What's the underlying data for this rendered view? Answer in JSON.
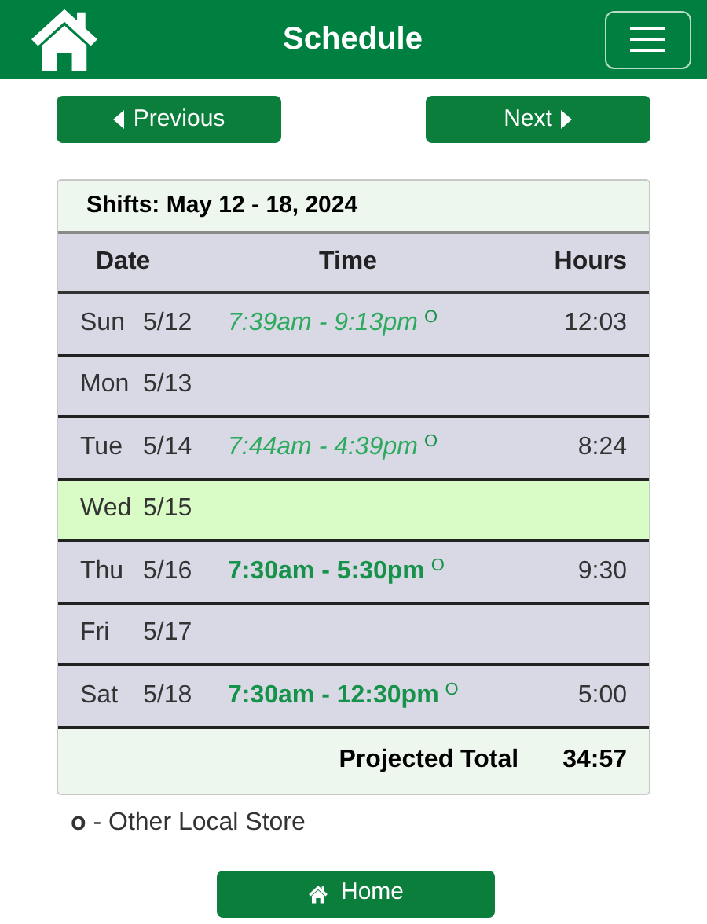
{
  "header": {
    "title": "Schedule"
  },
  "nav": {
    "previous": "Previous",
    "next": "Next"
  },
  "table": {
    "title": "Shifts: May 12 - 18, 2024",
    "columns": [
      "Date",
      "Time",
      "Hours"
    ],
    "rows": [
      {
        "day": "Sun",
        "date": "5/12",
        "time": "7:39am - 9:13pm",
        "kind": "past",
        "store_mark": "O",
        "hours": "12:03",
        "selected": false
      },
      {
        "day": "Mon",
        "date": "5/13",
        "selected": false
      },
      {
        "day": "Tue",
        "date": "5/14",
        "time": "7:44am - 4:39pm",
        "kind": "past",
        "store_mark": "O",
        "hours": "8:24",
        "selected": false
      },
      {
        "day": "Wed",
        "date": "5/15",
        "selected": true
      },
      {
        "day": "Thu",
        "date": "5/16",
        "time": "7:30am - 5:30pm",
        "kind": "planned",
        "store_mark": "O",
        "hours": "9:30",
        "selected": false
      },
      {
        "day": "Fri",
        "date": "5/17",
        "selected": false
      },
      {
        "day": "Sat",
        "date": "5/18",
        "time": "7:30am - 12:30pm",
        "kind": "planned",
        "store_mark": "O",
        "hours": "5:00",
        "selected": false
      }
    ],
    "total_label": "Projected Total",
    "total": "34:57"
  },
  "legend": "**o** - Other Local Store",
  "home_button": "Home"
}
